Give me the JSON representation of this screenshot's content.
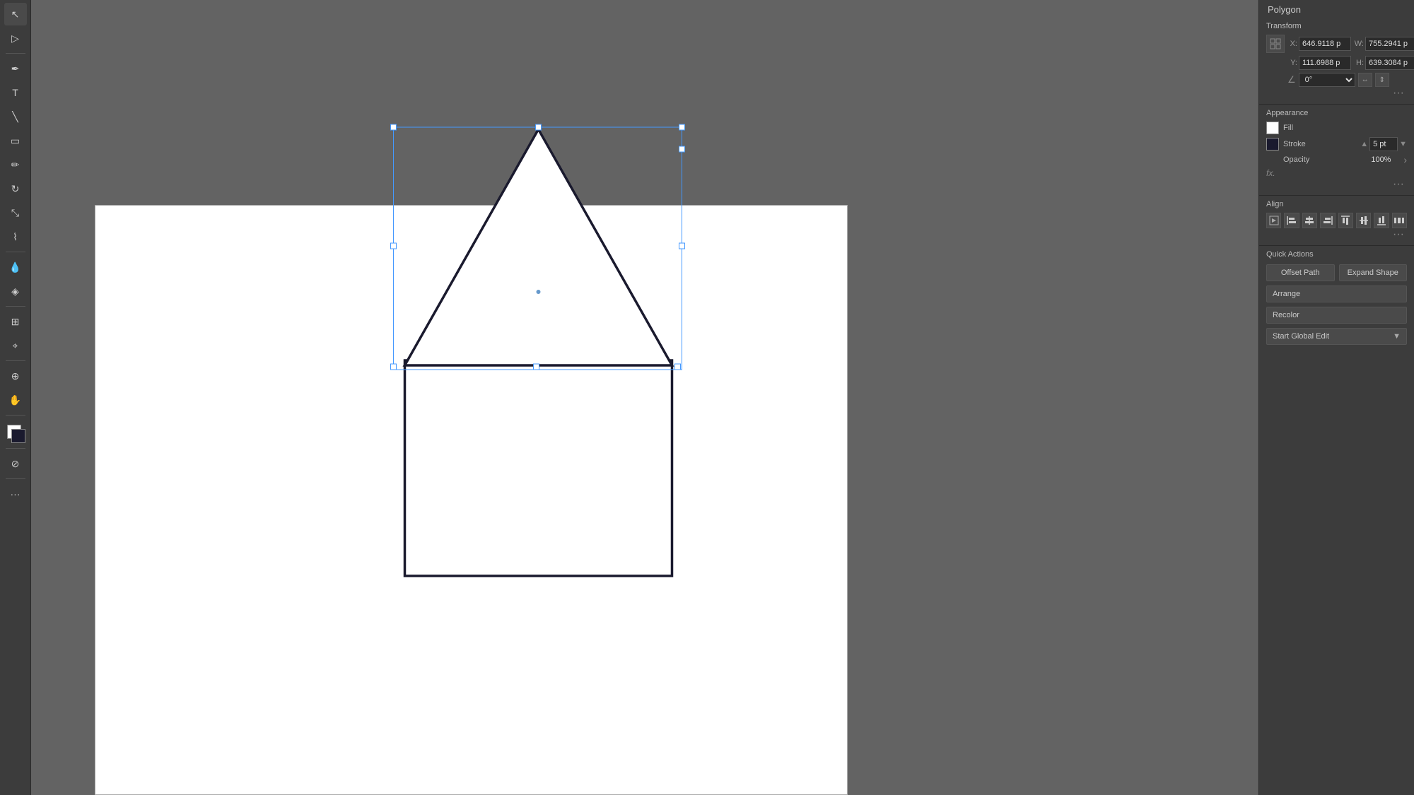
{
  "panel": {
    "polygon_label": "Polygon",
    "transform": {
      "title": "Transform",
      "x_label": "X:",
      "x_value": "646.9118 p",
      "y_label": "Y:",
      "y_value": "111.6988 p",
      "w_label": "W:",
      "w_value": "755.2941 p",
      "h_label": "H:",
      "h_value": "639.3084 p",
      "angle_value": "0°"
    },
    "appearance": {
      "title": "Appearance",
      "fill_label": "Fill",
      "stroke_label": "Stroke",
      "stroke_value": "5 pt",
      "opacity_label": "Opacity",
      "opacity_value": "100%",
      "fx_label": "fx."
    },
    "align": {
      "title": "Align"
    },
    "quick_actions": {
      "title": "Quick Actions",
      "offset_path": "Offset Path",
      "expand_shape": "Expand Shape",
      "arrange": "Arrange",
      "recolor": "Recolor",
      "start_global_edit": "Start Global Edit"
    }
  },
  "toolbar": {
    "tools": [
      "↖",
      "▶",
      "✏",
      "○",
      "✒",
      "T",
      "⌇",
      "✦",
      "◻",
      "⌖",
      "⊕",
      "◎",
      "☰",
      "⊘"
    ]
  }
}
